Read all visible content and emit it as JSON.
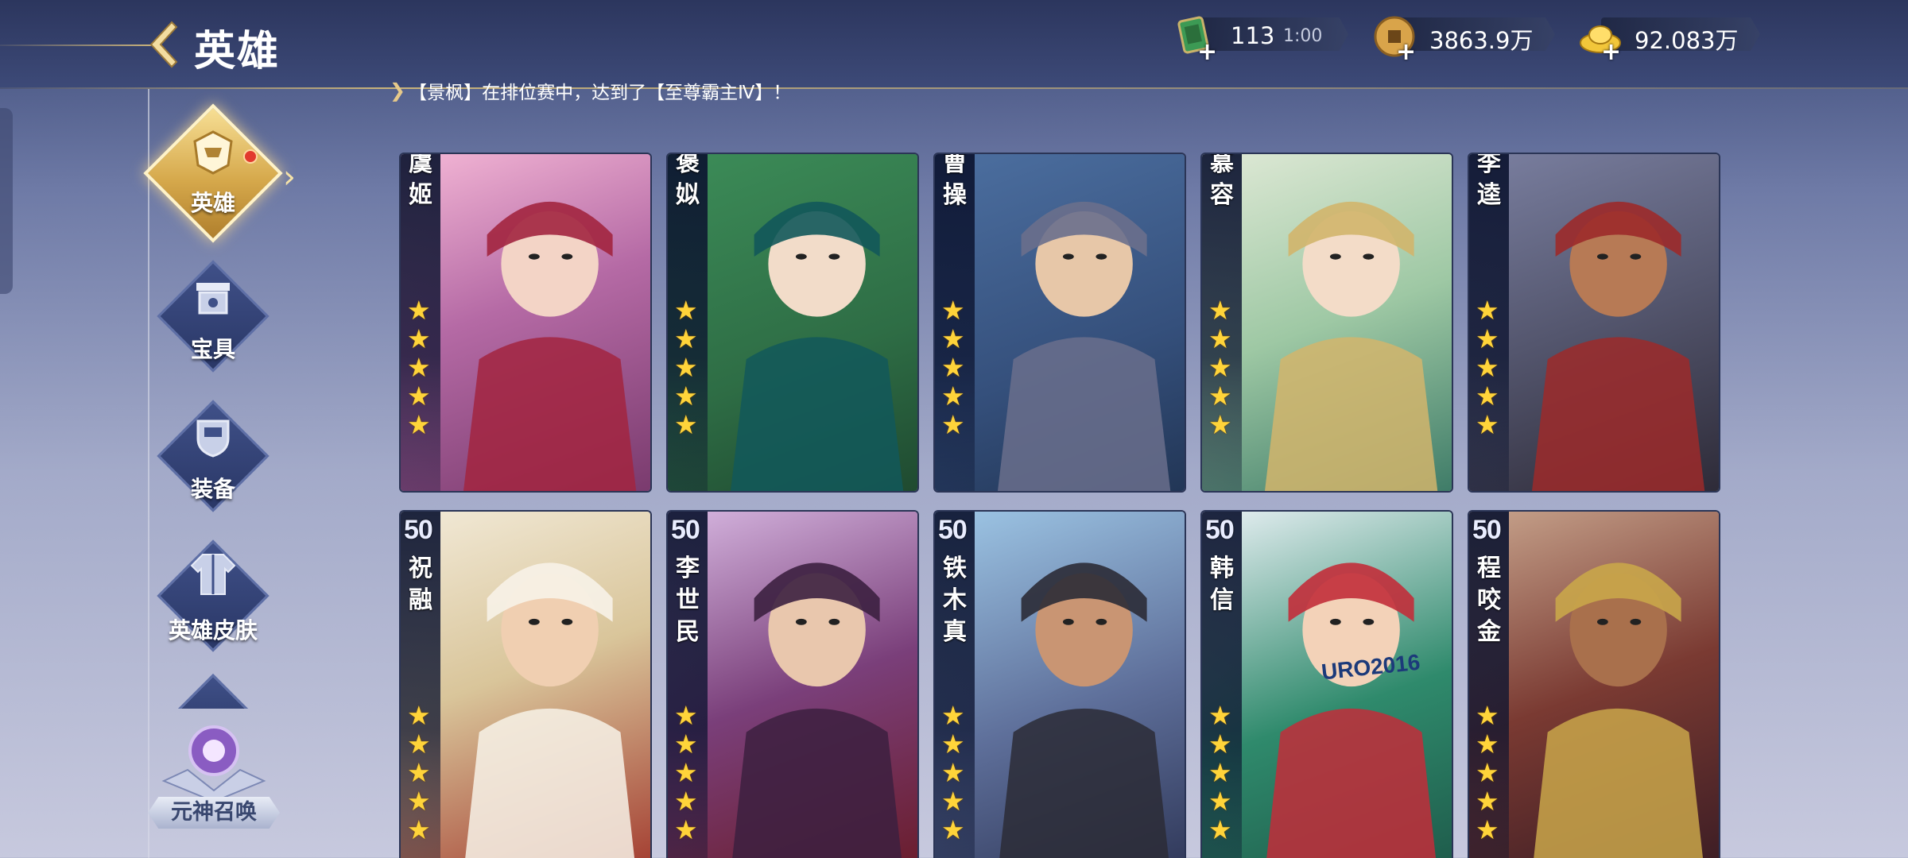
{
  "header": {
    "title": "英雄",
    "resources": [
      {
        "name": "stamina",
        "icon": "stamina-card-icon",
        "value": "113",
        "timer": "1:00",
        "color": "#3c9a54"
      },
      {
        "name": "copper",
        "icon": "copper-coin-icon",
        "value": "3863.9万",
        "color": "#d9a44a"
      },
      {
        "name": "gold",
        "icon": "gold-ingot-icon",
        "value": "92.083万",
        "color": "#f2c63a"
      }
    ]
  },
  "ticker": {
    "text": "【景枫】在排位赛中，达到了【至尊霸主Ⅳ】！"
  },
  "nav": {
    "items": [
      {
        "label": "英雄",
        "icon": "hero-helmet-icon",
        "active": true
      },
      {
        "label": "宝具",
        "icon": "treasure-icon",
        "active": false
      },
      {
        "label": "装备",
        "icon": "armor-icon",
        "active": false
      },
      {
        "label": "英雄皮肤",
        "icon": "robe-icon",
        "active": false
      }
    ],
    "summon": {
      "label": "元神召唤",
      "icon": "summon-orb-icon"
    }
  },
  "heroes": {
    "row1": [
      {
        "name": "虞姬",
        "level": "",
        "stars": 5
      },
      {
        "name": "褒姒",
        "level": "",
        "stars": 5
      },
      {
        "name": "曹操",
        "level": "",
        "stars": 5
      },
      {
        "name": "慕容",
        "level": "",
        "stars": 5
      },
      {
        "name": "李逵",
        "level": "",
        "stars": 5
      }
    ],
    "row2": [
      {
        "name": "祝融",
        "level": "50",
        "stars": 5
      },
      {
        "name": "李世民",
        "level": "50",
        "stars": 5
      },
      {
        "name": "铁木真",
        "level": "50",
        "stars": 5
      },
      {
        "name": "韩信",
        "level": "50",
        "stars": 5,
        "banner_text": "URO2016"
      },
      {
        "name": "程咬金",
        "level": "50",
        "stars": 5
      }
    ]
  },
  "theme": {
    "accent_gold": "#d6a94c",
    "star_color": "#ffd43a"
  }
}
